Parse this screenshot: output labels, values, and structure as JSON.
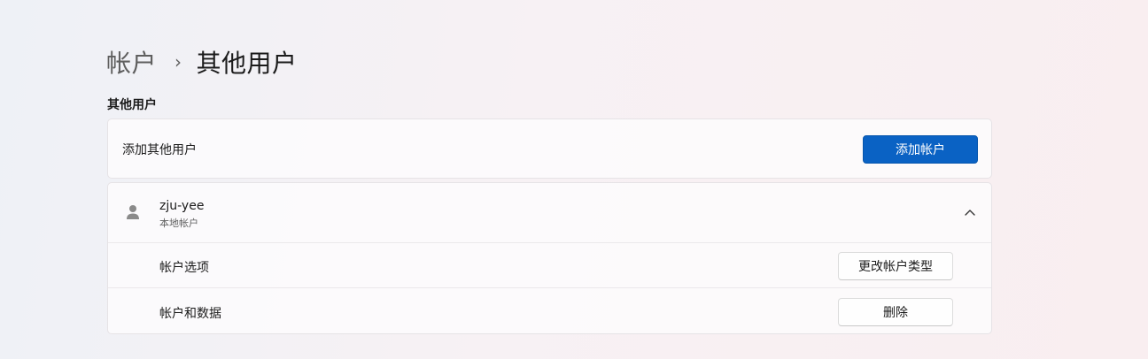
{
  "breadcrumb": {
    "parent": "帐户",
    "separator": "›",
    "current": "其他用户"
  },
  "section": {
    "title": "其他用户"
  },
  "add_user": {
    "label": "添加其他用户",
    "button_label": "添加帐户"
  },
  "user": {
    "name": "zju-yee",
    "type": "本地帐户",
    "icon": "person-icon",
    "expanded": true,
    "options": [
      {
        "label": "帐户选项",
        "button_label": "更改帐户类型"
      },
      {
        "label": "帐户和数据",
        "button_label": "删除"
      }
    ]
  },
  "colors": {
    "accent": "#0a62c4"
  }
}
